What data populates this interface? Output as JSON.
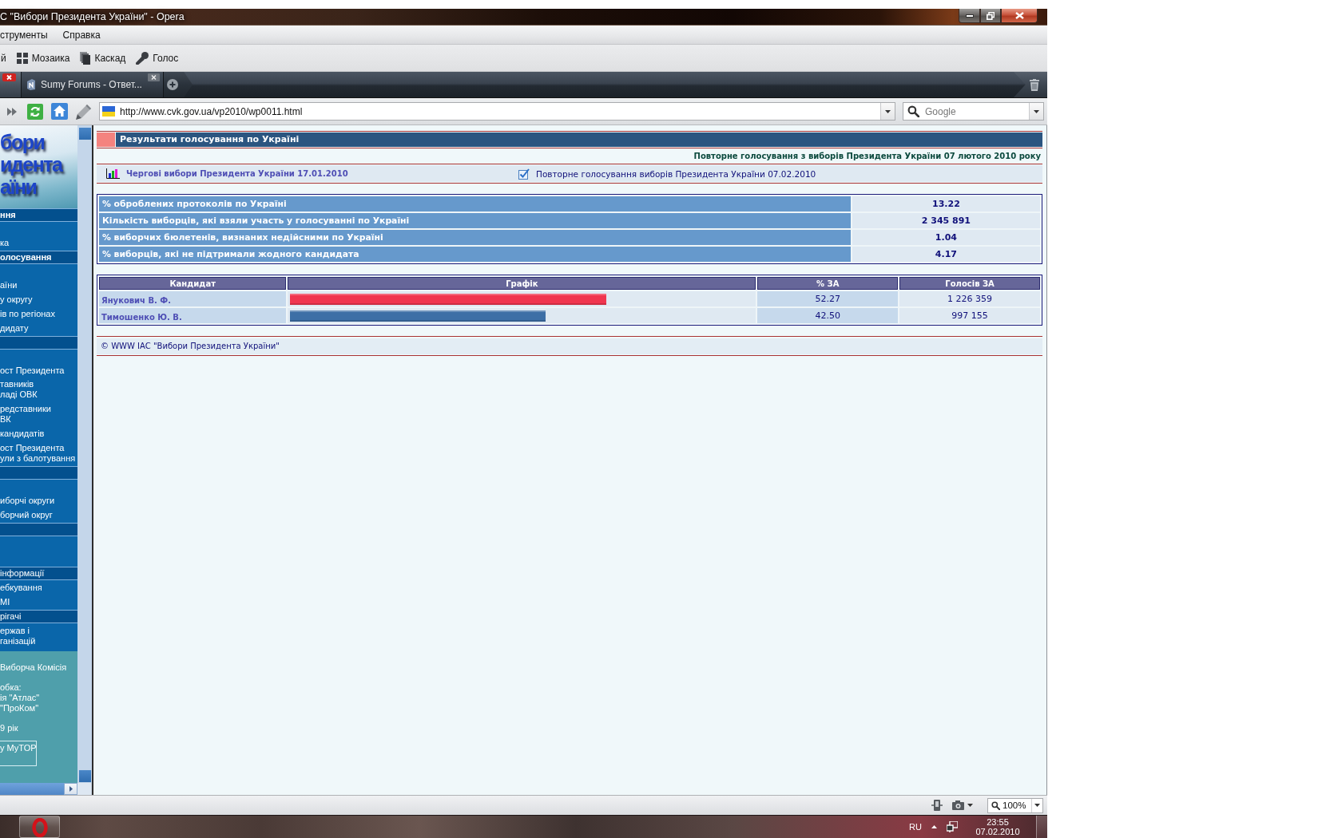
{
  "window": {
    "title": "С \"Вибори Президента України\" - Opera"
  },
  "menu_bar": [
    {
      "label": "струменты"
    },
    {
      "label": "Справка"
    }
  ],
  "toolbar": [
    {
      "kind": "text",
      "label": "й"
    },
    {
      "kind": "tile",
      "label": "Мозаика"
    },
    {
      "kind": "cascade",
      "label": "Каскад"
    },
    {
      "kind": "voice",
      "label": "Голос"
    }
  ],
  "tabs": [
    {
      "selected": true
    },
    {
      "label": "Sumy Forums - Ответ...",
      "selected": false
    }
  ],
  "address_bar": {
    "url": "http://www.cvk.gov.ua/vp2010/wp0011.html"
  },
  "search": {
    "placeholder": "Google"
  },
  "sidebar": {
    "logo": [
      "бори",
      "идента",
      "аїни"
    ],
    "items": [
      {
        "kind": "header",
        "label": "ння"
      },
      {
        "kind": "link",
        "lines": [
          "ка"
        ]
      },
      {
        "kind": "header",
        "label": "олосування"
      },
      {
        "kind": "link",
        "lines": [
          "аїни"
        ]
      },
      {
        "kind": "link",
        "lines": [
          "у округу"
        ]
      },
      {
        "kind": "link",
        "lines": [
          "ів по регіонах"
        ]
      },
      {
        "kind": "link",
        "lines": [
          "дидату"
        ]
      },
      {
        "kind": "header"
      },
      {
        "kind": "link",
        "lines": [
          "ост Президента"
        ]
      },
      {
        "kind": "link",
        "lines": [
          "тавників",
          "ладі ОВК"
        ]
      },
      {
        "kind": "link",
        "lines": [
          "редставники",
          "ВК"
        ]
      },
      {
        "kind": "link",
        "lines": [
          "кандидатів"
        ]
      },
      {
        "kind": "link",
        "lines": [
          "ост Президента",
          "ули з балотування"
        ]
      },
      {
        "kind": "header"
      },
      {
        "kind": "link",
        "lines": [
          "иборчі округи"
        ]
      },
      {
        "kind": "link",
        "lines": [
          "борчий округ"
        ]
      },
      {
        "kind": "header"
      },
      {
        "kind": "subheader",
        "label": "інформації"
      },
      {
        "kind": "link",
        "lines": [
          "ебкування"
        ]
      },
      {
        "kind": "link",
        "lines": [
          "МІ"
        ]
      },
      {
        "kind": "subheader",
        "label": "рігачі"
      },
      {
        "kind": "link",
        "lines": [
          "ержав і",
          "ганізацій"
        ]
      }
    ],
    "footer": {
      "paragraphs": [
        [
          "Виборча Комісія"
        ],
        [
          "обка:",
          "ія \"Атлас\"",
          "\"ПроКом\""
        ],
        [
          "9 рік"
        ]
      ],
      "counter": "у MyTOP"
    }
  },
  "page": {
    "title": "Результати голосування по Україні",
    "subtitle": "Повторне голосування з виборів Президента України 07 лютого 2010 року",
    "elections": [
      {
        "label": "Чергові вибори Президента України 17.01.2010",
        "selected": false
      },
      {
        "label": "Повторне голосування виборів Президента України 07.02.2010",
        "selected": true
      }
    ],
    "stats": [
      {
        "label": "% оброблених протоколів по Україні",
        "value": "13.22"
      },
      {
        "label": "Кількість виборців, які взяли участь у голосуванні по Україні",
        "value": "2 345 891"
      },
      {
        "label": "% виборчих бюлетенів, визнаних недійсними по Україні",
        "value": "1.04"
      },
      {
        "label": "% виборців, які не підтримали жодного кандидата",
        "value": "4.17"
      }
    ],
    "results": {
      "columns": [
        "Кандидат",
        "Графік",
        "% ЗА",
        "Голосів ЗА"
      ],
      "rows": [
        {
          "candidate": "Янукович В. Ф.",
          "level": 0.68,
          "color": "#f0364f",
          "percent": "52.27",
          "votes": "1 226 359"
        },
        {
          "candidate": "Тимошенко Ю. В.",
          "level": 0.55,
          "color": "#3d6fa6",
          "percent": "42.50",
          "votes": "997 155"
        }
      ]
    },
    "footer": "© WWW ІАС \"Вибори Президента України\""
  },
  "status_bar": {
    "zoom": "100%"
  },
  "taskbar": {
    "language": "RU",
    "time": "23:55",
    "date": "07.02.2010"
  }
}
